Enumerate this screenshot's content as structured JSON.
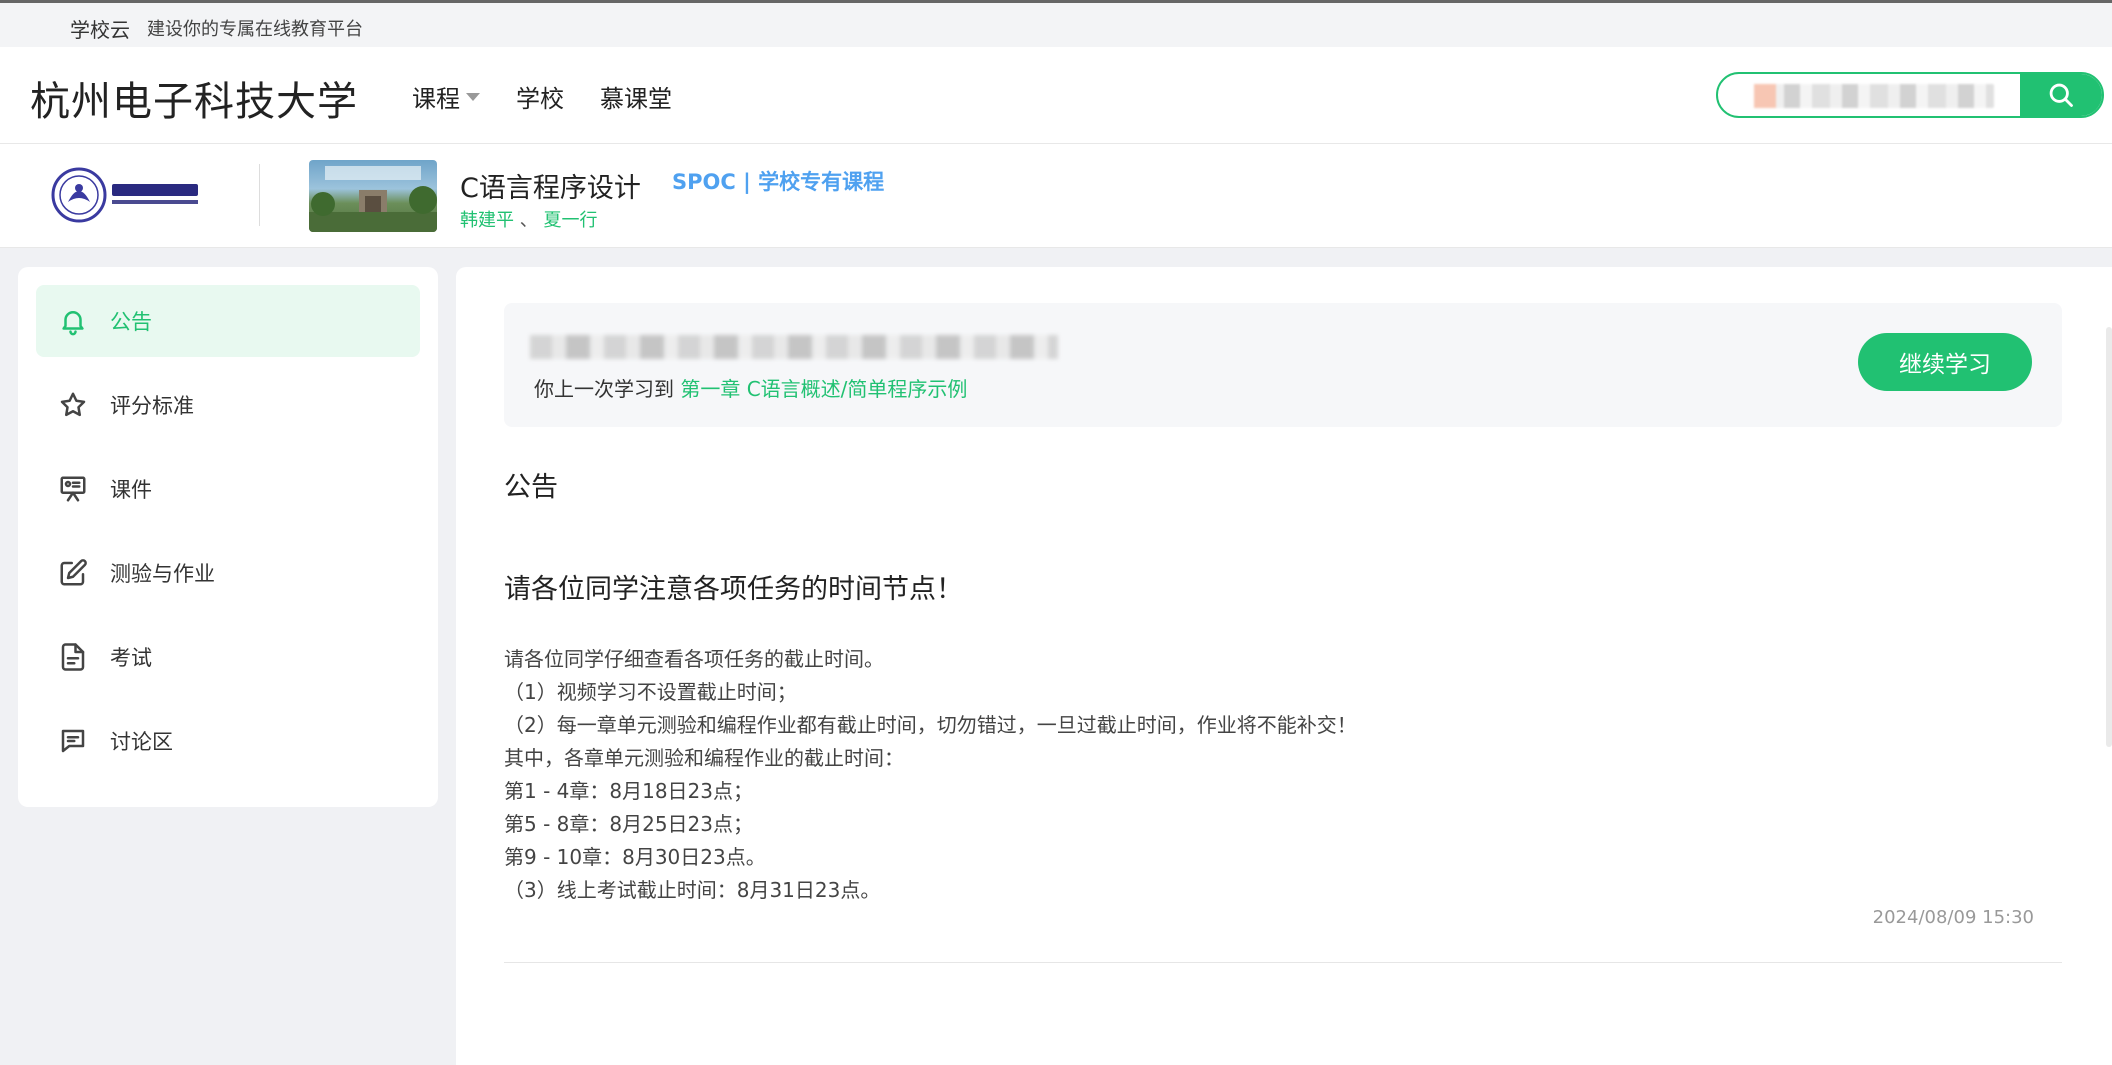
{
  "topbar": {
    "brand": "学校云",
    "slogan": "建设你的专属在线教育平台"
  },
  "header": {
    "school_name": "杭州电子科技大学",
    "nav": [
      {
        "label": "课程",
        "has_dropdown": true
      },
      {
        "label": "学校",
        "has_dropdown": false
      },
      {
        "label": "慕课堂",
        "has_dropdown": false
      }
    ],
    "search": {
      "placeholder": "",
      "value": "",
      "icon": "search-icon"
    }
  },
  "course": {
    "logo_icon": "university-logo",
    "title": "C语言程序设计",
    "teachers": [
      "韩建平",
      "夏一行"
    ],
    "teacher_separator": "、",
    "spoc_label": "SPOC | 学校专有课程"
  },
  "sidebar": {
    "items": [
      {
        "label": "公告",
        "icon": "bell-icon",
        "active": true
      },
      {
        "label": "评分标准",
        "icon": "star-icon",
        "active": false
      },
      {
        "label": "课件",
        "icon": "presentation-icon",
        "active": false
      },
      {
        "label": "测验与作业",
        "icon": "edit-icon",
        "active": false
      },
      {
        "label": "考试",
        "icon": "document-icon",
        "active": false
      },
      {
        "label": "讨论区",
        "icon": "chat-icon",
        "active": false
      }
    ]
  },
  "main": {
    "resume": {
      "prefix": "你上一次学习到",
      "link": "第一章 C语言概述/简单程序示例",
      "button": "继续学习"
    },
    "section_title": "公告",
    "announcement": {
      "title": "请各位同学注意各项任务的时间节点！",
      "lines": [
        "请各位同学仔细查看各项任务的截止时间。",
        "（1）视频学习不设置截止时间；",
        "（2）每一章单元测验和编程作业都有截止时间，切勿错过，一旦过截止时间，作业将不能补交！",
        "其中，各章单元测验和编程作业的截止时间：",
        "第1 - 4章：8月18日23点；",
        "第5 - 8章：8月25日23点；",
        "第9 - 10章：8月30日23点。",
        "（3）线上考试截止时间：8月31日23点。"
      ],
      "date": "2024/08/09 15:30"
    }
  },
  "colors": {
    "accent": "#21c172",
    "spoc": "#4fa1f0",
    "active_bg": "#e8f9f0"
  }
}
